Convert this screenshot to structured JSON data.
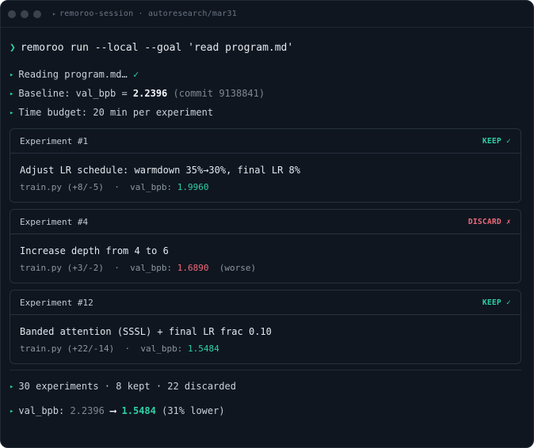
{
  "window": {
    "title_caret": "▸",
    "title": "remoroo-session · autoresearch/mar31"
  },
  "command": {
    "prompt": "❯",
    "text": "remoroo run --local --goal 'read program.md'"
  },
  "status_lines": {
    "reading": {
      "text": "Reading program.md…",
      "check": "✓"
    },
    "baseline": {
      "label": "Baseline: val_bpb = ",
      "value": "2.2396",
      "commit": "(commit 9138841)"
    },
    "budget": {
      "text": "Time budget: 20 min per experiment"
    }
  },
  "experiments": [
    {
      "title": "Experiment #1",
      "badge": "KEEP ✓",
      "status": "keep",
      "description": "Adjust LR schedule: warmdown 35%→30%, final LR 8%",
      "file": "train.py (+8/-5)",
      "sep": "·",
      "metric_label": "val_bpb:",
      "metric_value": "1.9960",
      "note": ""
    },
    {
      "title": "Experiment #4",
      "badge": "DISCARD ✗",
      "status": "discard",
      "description": "Increase depth from 4 to 6",
      "file": "train.py (+3/-2)",
      "sep": "·",
      "metric_label": "val_bpb:",
      "metric_value": "1.6890",
      "note": "(worse)"
    },
    {
      "title": "Experiment #12",
      "badge": "KEEP ✓",
      "status": "keep",
      "description": "Banded attention (SSSL) + final LR frac 0.10",
      "file": "train.py (+22/-14)",
      "sep": "·",
      "metric_label": "val_bpb:",
      "metric_value": "1.5484",
      "note": ""
    }
  ],
  "summary": {
    "counts": "30 experiments · 8 kept · 22 discarded",
    "result_label": "val_bpb:",
    "result_from": "2.2396",
    "result_arrow": "⟶",
    "result_to": "1.5484",
    "result_note": "(31% lower)"
  },
  "icons": {
    "bullet": "▸"
  },
  "colors": {
    "background": "#0f1620",
    "accent": "#2fd0a2",
    "discard": "#f0697a",
    "text": "#c9d0d8"
  }
}
